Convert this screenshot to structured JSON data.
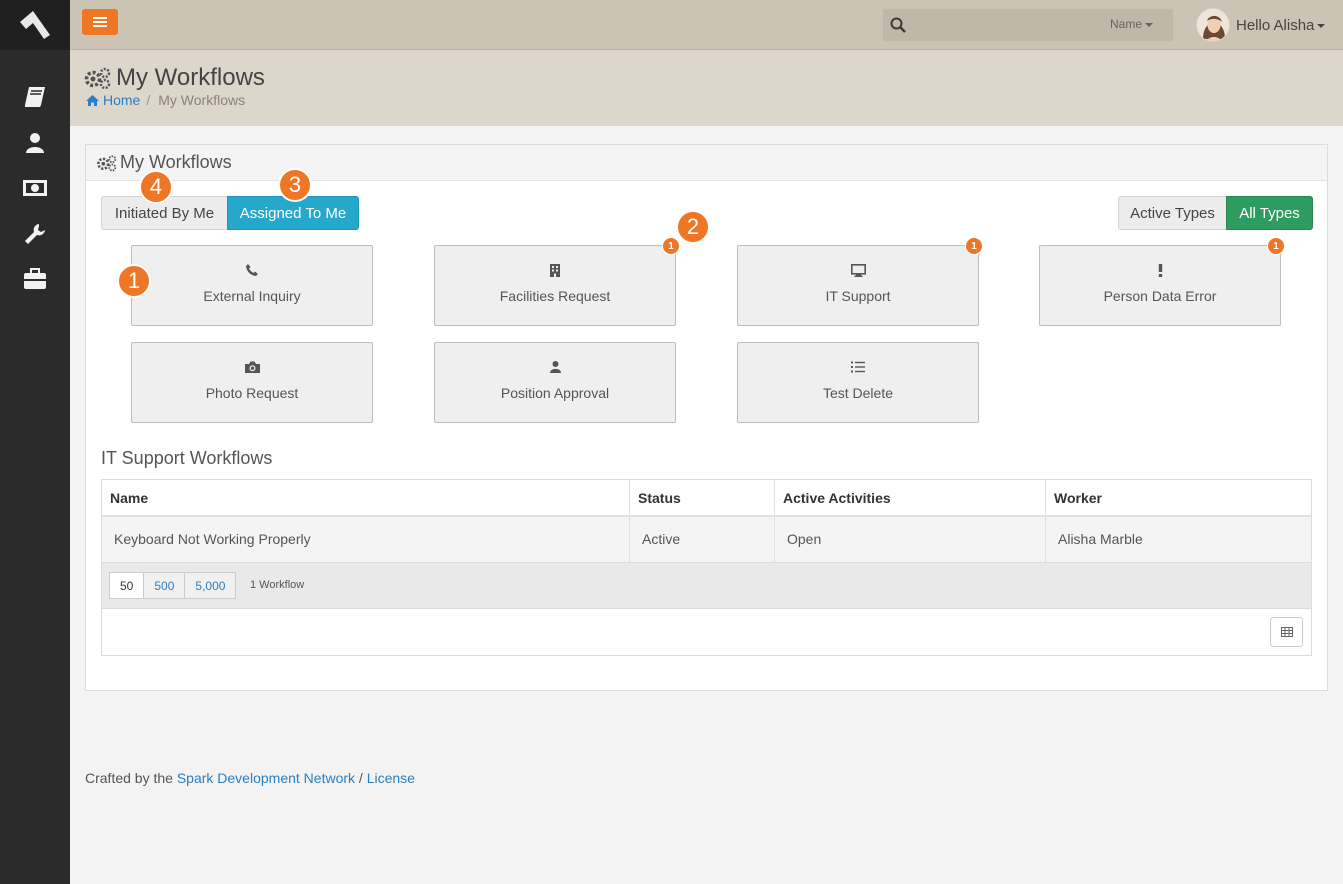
{
  "topbar": {
    "search_placeholder": "",
    "search_filter": "Name",
    "user_greeting": "Hello Alisha"
  },
  "sidebar": {
    "items": [
      {
        "icon": "book-icon"
      },
      {
        "icon": "person-icon"
      },
      {
        "icon": "money-icon"
      },
      {
        "icon": "wrench-icon"
      },
      {
        "icon": "briefcase-icon"
      }
    ]
  },
  "page": {
    "title": "My Workflows",
    "breadcrumb_home": "Home",
    "breadcrumb_current": "My Workflows"
  },
  "panel": {
    "title": "My Workflows",
    "toggle_initiated": "Initiated By Me",
    "toggle_assigned": "Assigned To Me",
    "toggle_active_types": "Active Types",
    "toggle_all_types": "All Types"
  },
  "workflow_types": [
    {
      "label": "External Inquiry",
      "icon": "phone-icon",
      "badge": ""
    },
    {
      "label": "Facilities Request",
      "icon": "building-icon",
      "badge": "1"
    },
    {
      "label": "IT Support",
      "icon": "desktop-icon",
      "badge": "1"
    },
    {
      "label": "Person Data Error",
      "icon": "exclamation-icon",
      "badge": "1"
    },
    {
      "label": "Photo Request",
      "icon": "camera-icon",
      "badge": ""
    },
    {
      "label": "Position Approval",
      "icon": "user-icon",
      "badge": ""
    },
    {
      "label": "Test Delete",
      "icon": "list-icon",
      "badge": ""
    }
  ],
  "callouts": [
    "1",
    "2",
    "3",
    "4"
  ],
  "grid": {
    "title": "IT Support Workflows",
    "columns": [
      "Name",
      "Status",
      "Active Activities",
      "Worker"
    ],
    "rows": [
      [
        "Keyboard Not Working Properly",
        "Active",
        "Open",
        "Alisha Marble"
      ]
    ],
    "page_sizes": [
      "50",
      "500",
      "5,000"
    ],
    "count_text": "1 Workflow"
  },
  "footer": {
    "prefix": "Crafted by the",
    "link1": "Spark Development Network",
    "sep": "/",
    "link2": "License"
  },
  "colors": {
    "accent_orange": "#ee7624",
    "assigned_blue": "#26a8cd",
    "all_types_green": "#2e9b5f",
    "link_blue": "#2a7fc1"
  }
}
